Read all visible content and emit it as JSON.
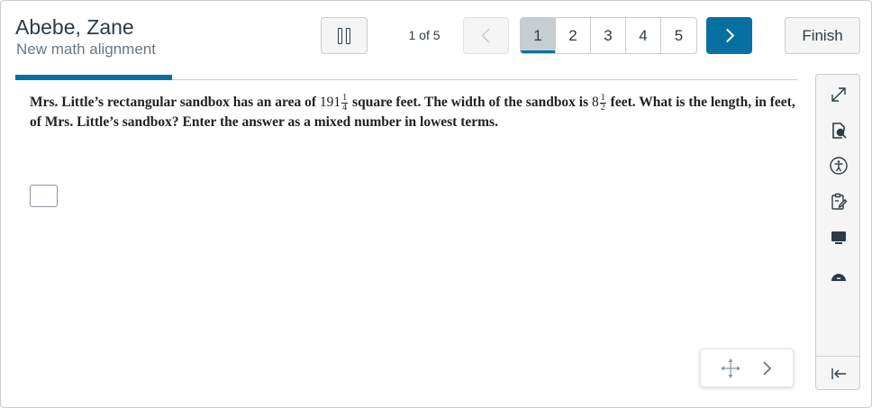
{
  "header": {
    "student_name": "Abebe, Zane",
    "quiz_name": "New math alignment"
  },
  "navigation": {
    "position_text": "1 of 5",
    "pages": [
      "1",
      "2",
      "3",
      "4",
      "5"
    ],
    "active_page": "1",
    "finish_label": "Finish"
  },
  "progress": {
    "fraction": 0.2
  },
  "question": {
    "text_before_area": "Mrs. Little’s rectangular sandbox has an area of ",
    "area_whole": "191",
    "area_num": "1",
    "area_den": "4",
    "text_before_width": " square feet. The width of the sandbox is ",
    "width_whole": "8",
    "width_num": "1",
    "width_den": "2",
    "text_after": " feet. What is the length, in feet, of Mrs. Little’s sandbox? Enter the answer as a mixed number in lowest terms."
  },
  "answer": {
    "value": ""
  },
  "tools": [
    "expand-icon",
    "magnifier-icon",
    "accessibility-icon",
    "notepad-icon",
    "monitor-icon",
    "circle-icon",
    "collapse-left-icon"
  ],
  "floating_nav": {
    "icons": [
      "move-icon",
      "chevron-right-icon"
    ]
  },
  "colors": {
    "accent": "#0770a3",
    "text": "#2d3b45",
    "muted": "#6b7780",
    "border": "#c7cdd1"
  }
}
